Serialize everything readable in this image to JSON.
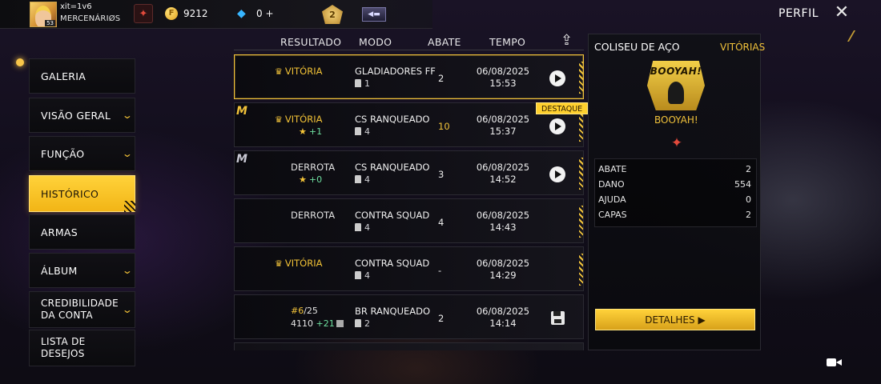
{
  "player": {
    "nickname": "xit=1v6",
    "guild": "MERCENÁRIØS",
    "level": "53"
  },
  "currency": {
    "coins": "9212",
    "diamonds": "0",
    "diamonds_plus": "+"
  },
  "rank_badge": "2",
  "header": {
    "profile_title": "PERFIL",
    "close_symbol": "✕"
  },
  "sidebar": {
    "items": [
      {
        "label": "GALERIA",
        "has_chevron": false
      },
      {
        "label": "VISÃO GERAL",
        "has_chevron": true
      },
      {
        "label": "FUNÇÃO",
        "has_chevron": true
      },
      {
        "label": "HISTÓRICO",
        "has_chevron": false,
        "active": true
      },
      {
        "label": "ARMAS",
        "has_chevron": false
      },
      {
        "label": "ÁLBUM",
        "has_chevron": true
      },
      {
        "label": "CREDIBILIDADE DA CONTA",
        "line1": "CREDIBILIDADE",
        "line2": "DA CONTA",
        "has_chevron": true
      },
      {
        "label": "LISTA DE DESEJOS",
        "line1": "LISTA DE",
        "line2": "DESEJOS",
        "has_chevron": false
      }
    ],
    "chevron_symbol": "⌄"
  },
  "table": {
    "columns": [
      "RESULTADO",
      "MODO",
      "ABATE",
      "TEMPO"
    ],
    "rows": [
      {
        "result": "VITÓRIA",
        "outcome": "win",
        "mode": "GLADIADORES FF",
        "squad": "1",
        "kills": "2",
        "date": "06/08/2025",
        "time": "15:53",
        "action": "play"
      },
      {
        "result": "VITÓRIA",
        "outcome": "win",
        "stars": "★",
        "star_delta": "+1",
        "mode": "CS RANQUEADO",
        "squad": "4",
        "kills": "10",
        "date": "06/08/2025",
        "time": "15:37",
        "action": "play",
        "tag": "DESTAQUE"
      },
      {
        "result": "DERROTA",
        "outcome": "loss",
        "stars": "★",
        "star_delta": "+0",
        "mode": "CS RANQUEADO",
        "squad": "4",
        "kills": "3",
        "date": "06/08/2025",
        "time": "14:52",
        "action": "play"
      },
      {
        "result": "DERROTA",
        "outcome": "loss",
        "mode": "CONTRA SQUAD",
        "squad": "4",
        "kills": "4",
        "date": "06/08/2025",
        "time": "14:43",
        "action": "none"
      },
      {
        "result": "VITÓRIA",
        "outcome": "win",
        "mode": "CONTRA SQUAD",
        "squad": "4",
        "kills": "-",
        "date": "06/08/2025",
        "time": "14:29",
        "action": "none"
      },
      {
        "rank_position": "#6",
        "rank_total": "/25",
        "points": "4110",
        "points_delta": "+21",
        "mode": "BR RANQUEADO",
        "squad": "2",
        "kills": "2",
        "date": "06/08/2025",
        "time": "14:14",
        "action": "save"
      }
    ],
    "row_badges": {
      "row2": "M",
      "row3": "M"
    }
  },
  "panel": {
    "mode_title": "COLISEU DE AÇO",
    "result": "VITÓRIAS",
    "logo_text": "BOOYAH!",
    "booyah_label": "BOOYAH!",
    "stats": [
      {
        "label": "ABATE",
        "value": "2"
      },
      {
        "label": "DANO",
        "value": "554"
      },
      {
        "label": "AJUDA",
        "value": "0"
      },
      {
        "label": "CAPAS",
        "value": "2"
      }
    ],
    "details_button": "DETALHES ▶"
  },
  "colors": {
    "accent": "#f1c23a",
    "win": "#f2c236",
    "loss": "#e2e2e2",
    "gain": "#6fe0a0",
    "background": "#120e1c"
  },
  "icons": [
    "avatar",
    "guild-emblem-icon",
    "coin-icon",
    "diamond-icon",
    "rank-badge-icon",
    "flag-icon",
    "close-icon",
    "share-icon",
    "trophy-icon",
    "star-icon",
    "person-icon",
    "play-icon",
    "save-icon",
    "video-icon"
  ]
}
